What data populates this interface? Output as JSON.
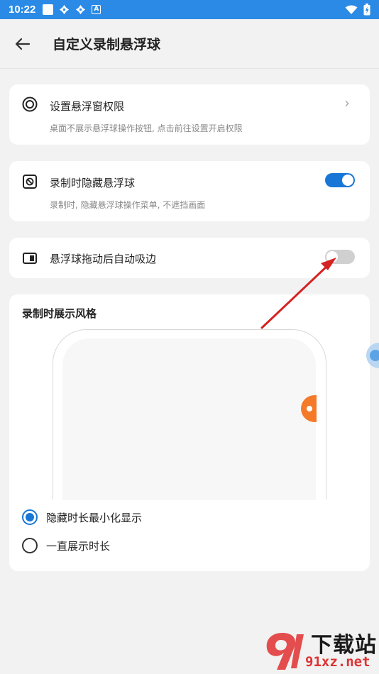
{
  "status_bar": {
    "time": "10:22",
    "left_icons": [
      "square-icon",
      "pinwheel-icon",
      "pinwheel-icon",
      "a-icon"
    ],
    "right_icons": [
      "wifi-icon",
      "battery-icon"
    ]
  },
  "app_bar": {
    "title": "自定义录制悬浮球"
  },
  "settings": {
    "permission": {
      "title": "设置悬浮窗权限",
      "subtitle": "桌面不展示悬浮球操作按钮, 点击前往设置开启权限"
    },
    "hide_ball": {
      "title": "录制时隐藏悬浮球",
      "subtitle": "录制时, 隐藏悬浮球操作菜单, 不遮挡画面",
      "enabled": true
    },
    "auto_snap": {
      "title": "悬浮球拖动后自动吸边",
      "enabled": false
    }
  },
  "display_style": {
    "title": "录制时展示风格",
    "options": [
      {
        "label": "隐藏时长最小化显示",
        "selected": true
      },
      {
        "label": "一直展示时长",
        "selected": false
      }
    ]
  },
  "colors": {
    "accent": "#1877d6",
    "status_bar": "#2a8ae6",
    "float_ball": "#f47a2a",
    "annotation_arrow": "#d62222"
  },
  "watermark": {
    "title": "下载站",
    "url": "91xz.net"
  }
}
